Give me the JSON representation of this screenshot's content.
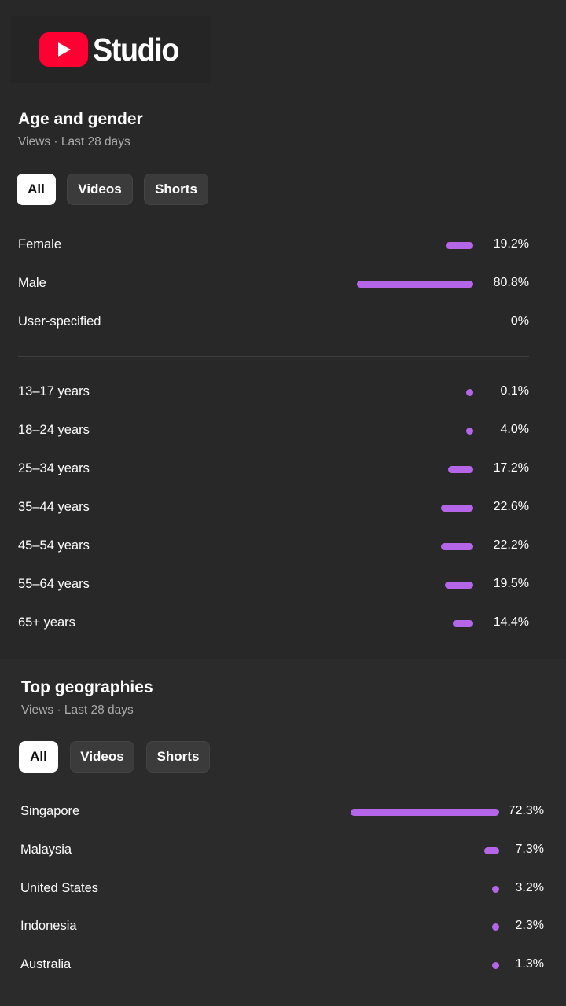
{
  "logo": {
    "text": "Studio"
  },
  "colors": {
    "bar": "#b566e8",
    "background": "#282828",
    "brand_red": "#ff0033"
  },
  "age_gender": {
    "title": "Age and gender",
    "subtitle": "Views · Last 28 days",
    "chips": [
      {
        "label": "All",
        "active": true
      },
      {
        "label": "Videos",
        "active": false
      },
      {
        "label": "Shorts",
        "active": false
      }
    ],
    "gender": [
      {
        "label": "Female",
        "pct": "19.2%",
        "value": 19.2
      },
      {
        "label": "Male",
        "pct": "80.8%",
        "value": 80.8
      },
      {
        "label": "User-specified",
        "pct": "0%",
        "value": 0
      }
    ],
    "age": [
      {
        "label": "13–17 years",
        "pct": "0.1%",
        "value": 0.1
      },
      {
        "label": "18–24 years",
        "pct": "4.0%",
        "value": 4.0
      },
      {
        "label": "25–34 years",
        "pct": "17.2%",
        "value": 17.2
      },
      {
        "label": "35–44 years",
        "pct": "22.6%",
        "value": 22.6
      },
      {
        "label": "45–54 years",
        "pct": "22.2%",
        "value": 22.2
      },
      {
        "label": "55–64 years",
        "pct": "19.5%",
        "value": 19.5
      },
      {
        "label": "65+ years",
        "pct": "14.4%",
        "value": 14.4
      }
    ]
  },
  "geographies": {
    "title": "Top geographies",
    "subtitle": "Views · Last 28 days",
    "chips": [
      {
        "label": "All",
        "active": true
      },
      {
        "label": "Videos",
        "active": false
      },
      {
        "label": "Shorts",
        "active": false
      }
    ],
    "rows": [
      {
        "label": "Singapore",
        "pct": "72.3%",
        "value": 72.3
      },
      {
        "label": "Malaysia",
        "pct": "7.3%",
        "value": 7.3
      },
      {
        "label": "United States",
        "pct": "3.2%",
        "value": 3.2
      },
      {
        "label": "Indonesia",
        "pct": "2.3%",
        "value": 2.3
      },
      {
        "label": "Australia",
        "pct": "1.3%",
        "value": 1.3
      }
    ]
  }
}
